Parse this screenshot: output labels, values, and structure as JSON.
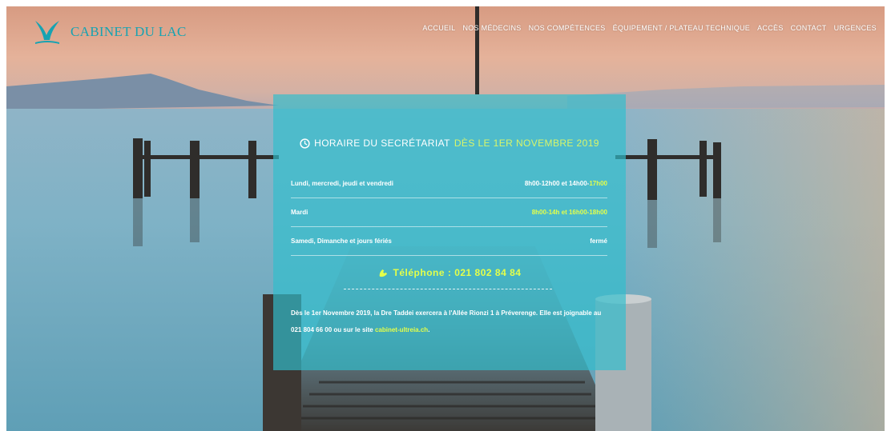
{
  "header": {
    "logo_text": "CABINET DU LAC",
    "nav": [
      {
        "label": "ACCUEIL"
      },
      {
        "label": "NOS MÉDECINS"
      },
      {
        "label": "NOS COMPÉTENCES"
      },
      {
        "label": "ÉQUIPEMENT / PLATEAU TECHNIQUE"
      },
      {
        "label": "ACCÈS"
      },
      {
        "label": "CONTACT"
      },
      {
        "label": "URGENCES"
      }
    ]
  },
  "panel": {
    "title_main": "HORAIRE DU SECRÉTARIAT",
    "title_highlight": "DÈS LE 1ER NOVEMBRE 2019",
    "hours": [
      {
        "day": "Lundi, mercredi, jeudi et vendredi",
        "time_main": "8h00-12h00 et 14h00-",
        "time_highlight": "17h00"
      },
      {
        "day": "Mardi",
        "time_main": "",
        "time_highlight": "8h00-14h et 16h00-18h00"
      },
      {
        "day": "Samedi, Dimanche et jours fériés",
        "time_main": "fermé",
        "time_highlight": ""
      }
    ],
    "phone": "Téléphone : 021 802 84 84",
    "notice_text": "Dès le 1er Novembre 2019, la Dre Taddei exercera à l'Allée Rionzi 1 à Préverenge. Elle est joignable au 021 804 66 00 ou sur le site ",
    "notice_link": "cabinet-ultreia.ch",
    "notice_end": "."
  },
  "icons": {
    "clock": "clock-icon",
    "phone": "phone-icon",
    "logo": "heron-logo-icon"
  },
  "colors": {
    "accent": "#17a3b2",
    "highlight": "#e4ff4a",
    "panel": "#30becd"
  }
}
